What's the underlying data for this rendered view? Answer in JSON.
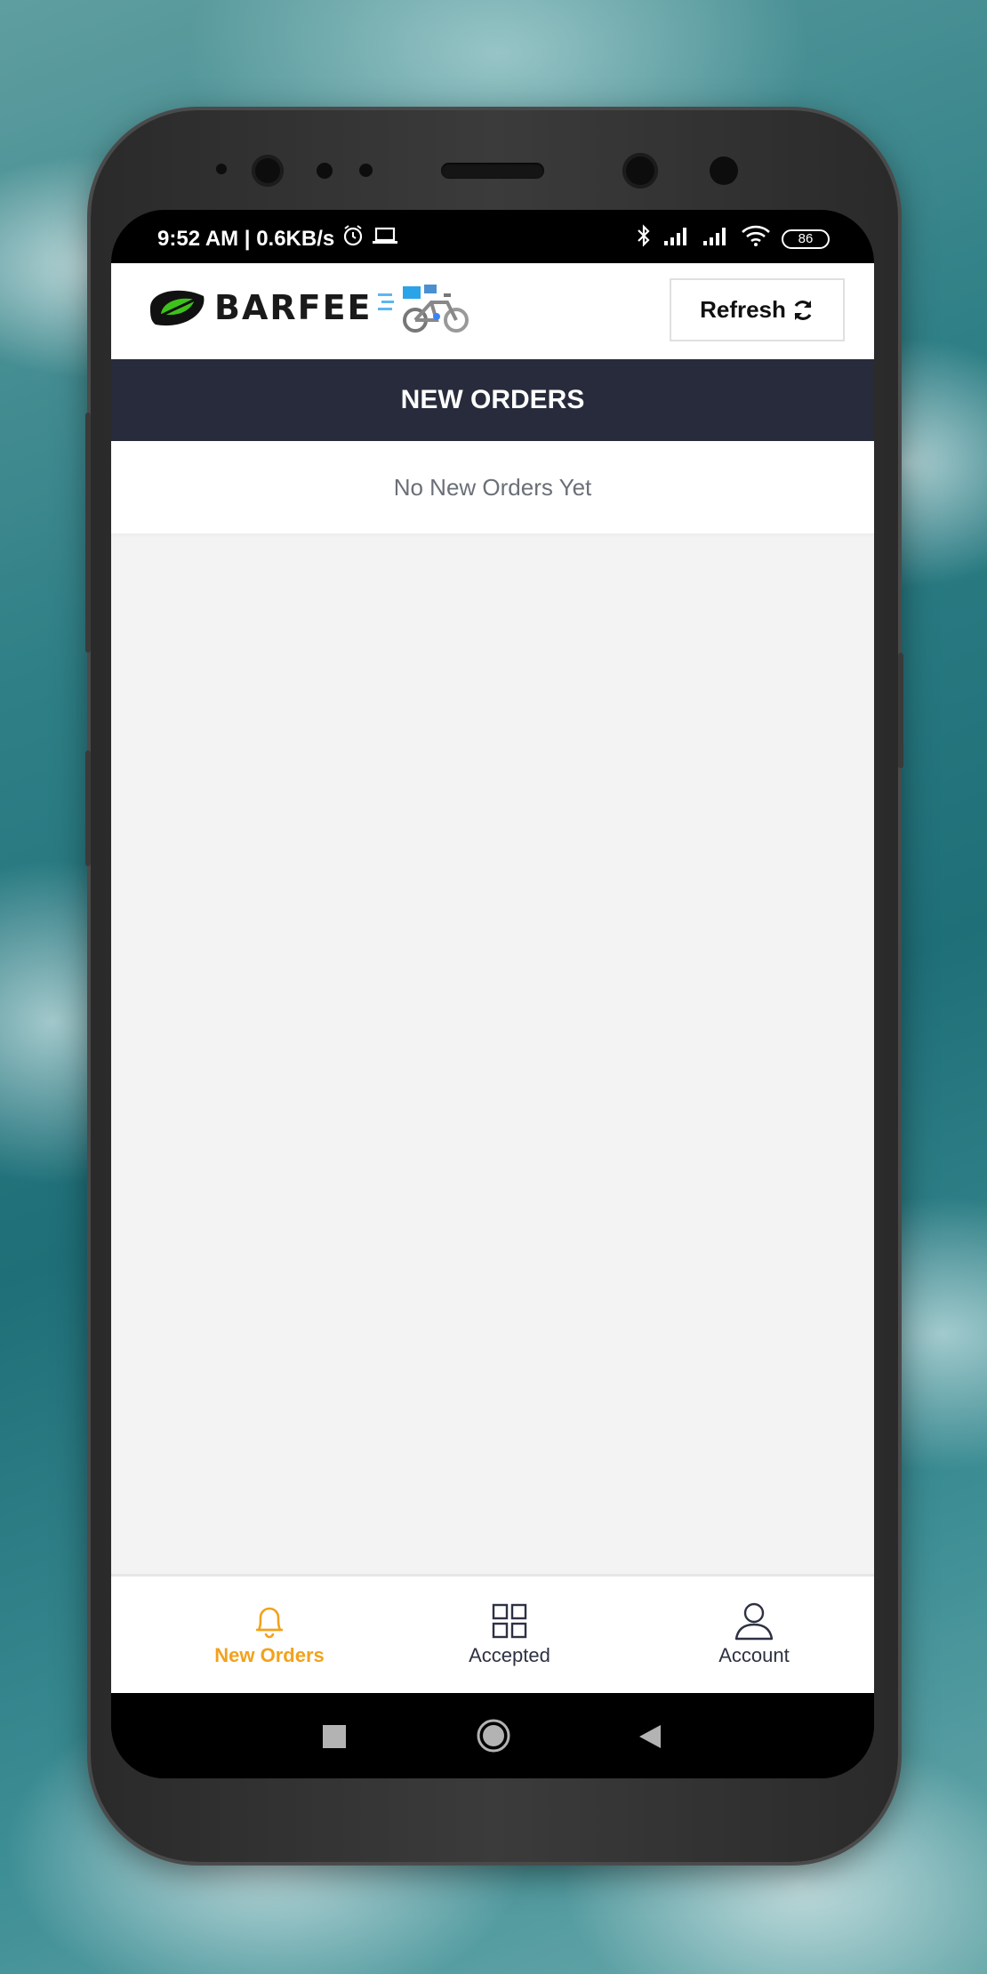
{
  "status_bar": {
    "time_speed": "9:52 AM | 0.6KB/s",
    "battery": "86",
    "icons": [
      "alarm-icon",
      "laptop-icon",
      "bluetooth-icon",
      "signal-icon",
      "signal-icon",
      "wifi-icon",
      "battery-icon"
    ]
  },
  "header": {
    "logo_text": "BARFEE",
    "refresh_label": "Refresh"
  },
  "page": {
    "title": "NEW ORDERS",
    "empty_message": "No New Orders Yet"
  },
  "bottom_nav": {
    "items": [
      {
        "label": "New Orders",
        "icon": "bell-icon",
        "active": true
      },
      {
        "label": "Accepted",
        "icon": "grid-icon",
        "active": false
      },
      {
        "label": "Account",
        "icon": "user-icon",
        "active": false
      }
    ]
  },
  "colors": {
    "accent": "#f2a21b",
    "title_bar": "#272b3b",
    "logo_green": "#3ec21b"
  }
}
